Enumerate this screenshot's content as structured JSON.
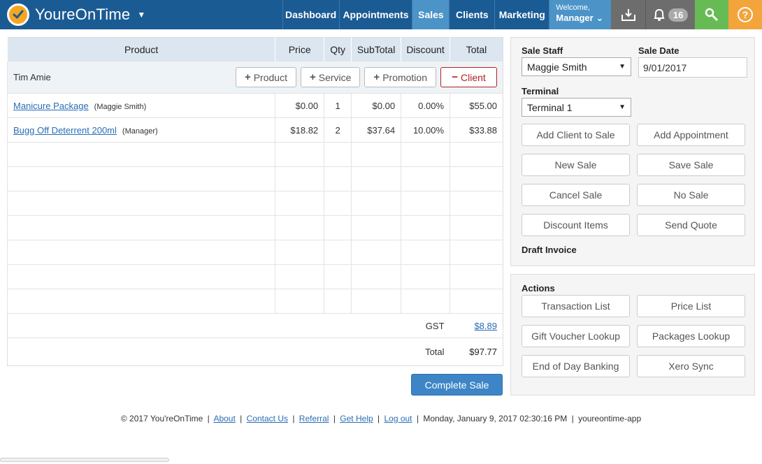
{
  "brand": {
    "name": "YoureOnTime"
  },
  "nav": {
    "dashboard": "Dashboard",
    "appointments": "Appointments",
    "sales": "Sales",
    "clients": "Clients",
    "marketing": "Marketing",
    "welcome": "Welcome,",
    "user": "Manager",
    "notification_count": "16",
    "help_glyph": "?"
  },
  "table": {
    "headers": {
      "product": "Product",
      "price": "Price",
      "qty": "Qty",
      "subtotal": "SubTotal",
      "discount": "Discount",
      "total": "Total"
    },
    "client_name": "Tim Amie",
    "buttons": {
      "product": "Product",
      "service": "Service",
      "promotion": "Promotion",
      "client": "Client"
    },
    "items": [
      {
        "name": "Manicure Package",
        "staff": "(Maggie Smith)",
        "price": "$0.00",
        "qty": "1",
        "subtotal": "$0.00",
        "discount": "0.00%",
        "total": "$55.00"
      },
      {
        "name": "Bugg Off Deterrent 200ml",
        "staff": "(Manager)",
        "price": "$18.82",
        "qty": "2",
        "subtotal": "$37.64",
        "discount": "10.00%",
        "total": "$33.88"
      }
    ],
    "gst_label": "GST",
    "gst_value": "$8.89",
    "total_label": "Total",
    "total_value": "$97.77"
  },
  "complete_sale": "Complete Sale",
  "panel": {
    "sale_staff_label": "Sale Staff",
    "sale_staff_value": "Maggie Smith",
    "sale_date_label": "Sale Date",
    "sale_date_value": "9/01/2017",
    "terminal_label": "Terminal",
    "terminal_value": "Terminal 1",
    "buttons": {
      "add_client": "Add Client to Sale",
      "add_appointment": "Add Appointment",
      "new_sale": "New Sale",
      "save_sale": "Save Sale",
      "cancel_sale": "Cancel Sale",
      "no_sale": "No Sale",
      "discount_items": "Discount Items",
      "send_quote": "Send Quote"
    },
    "draft_invoice": "Draft Invoice"
  },
  "actions": {
    "label": "Actions",
    "transaction_list": "Transaction List",
    "price_list": "Price List",
    "gift_voucher": "Gift Voucher Lookup",
    "packages": "Packages Lookup",
    "end_of_day": "End of Day Banking",
    "xero": "Xero Sync"
  },
  "footer": {
    "copyright": "© 2017 You'reOnTime",
    "about": "About",
    "contact": "Contact Us",
    "referral": "Referral",
    "get_help": "Get Help",
    "logout": "Log out",
    "datetime": "Monday, January 9, 2017  02:30:16 PM",
    "app": "youreontime-app"
  }
}
